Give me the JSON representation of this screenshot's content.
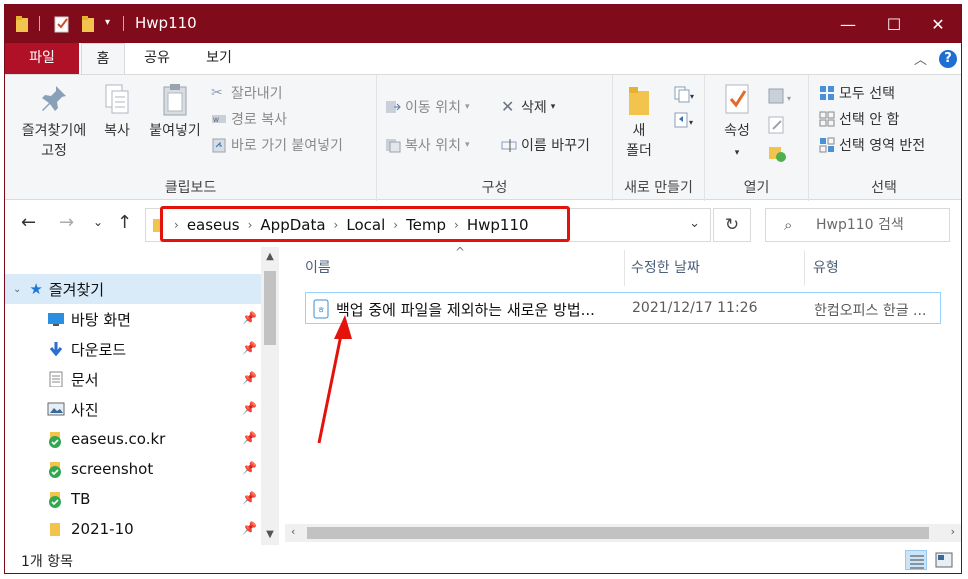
{
  "window": {
    "title": "Hwp110",
    "controls": {
      "minimize": "—",
      "maximize": "☐",
      "close": "✕"
    }
  },
  "ribbon": {
    "tabs": [
      {
        "label": "파일",
        "active": false
      },
      {
        "label": "홈",
        "active": true
      },
      {
        "label": "공유",
        "active": false
      },
      {
        "label": "보기",
        "active": false
      }
    ],
    "groups": {
      "clipboard": {
        "label": "클립보드",
        "pin_label_1": "즐겨찾기에",
        "pin_label_2": "고정",
        "copy_label": "복사",
        "paste_label": "붙여넣기",
        "cut_label": "잘라내기",
        "copy_path_label": "경로 복사",
        "paste_shortcut_label": "바로 가기 붙여넣기"
      },
      "organize": {
        "label": "구성",
        "move_to_label": "이동 위치",
        "copy_to_label": "복사 위치",
        "delete_label": "삭제",
        "rename_label": "이름 바꾸기"
      },
      "new": {
        "label": "새로 만들기",
        "new_folder_label_1": "새",
        "new_folder_label_2": "폴더"
      },
      "open": {
        "label": "열기",
        "properties_label": "속성"
      },
      "select": {
        "label": "선택",
        "select_all_label": "모두 선택",
        "select_none_label": "선택 안 함",
        "invert_label": "선택 영역 반전"
      }
    }
  },
  "address": {
    "breadcrumbs": [
      "easeus",
      "AppData",
      "Local",
      "Temp",
      "Hwp110"
    ],
    "search_placeholder": "Hwp110 검색"
  },
  "nav_pane": {
    "header": "즐겨찾기",
    "items": [
      {
        "label": "바탕 화면",
        "icon": "desktop-icon",
        "pinned": true
      },
      {
        "label": "다운로드",
        "icon": "download-icon",
        "pinned": true
      },
      {
        "label": "문서",
        "icon": "document-icon",
        "pinned": true
      },
      {
        "label": "사진",
        "icon": "pictures-icon",
        "pinned": true
      },
      {
        "label": "easeus.co.kr",
        "icon": "synced-folder-icon",
        "pinned": true
      },
      {
        "label": "screenshot",
        "icon": "synced-folder-icon",
        "pinned": true
      },
      {
        "label": "TB",
        "icon": "synced-folder-icon",
        "pinned": true
      },
      {
        "label": "2021-10",
        "icon": "folder-icon",
        "pinned": true
      }
    ]
  },
  "file_list": {
    "columns": [
      "이름",
      "수정한 날짜",
      "유형"
    ],
    "rows": [
      {
        "name": "백업 중에 파일을 제외하는 새로운 방법...",
        "modified": "2021/12/17 11:26",
        "type": "한컴오피스 한글 ..."
      }
    ]
  },
  "status": {
    "item_count": "1개 항목"
  },
  "colors": {
    "titlebar": "#7f0b1b",
    "file_tab": "#b01127",
    "highlight_box": "#e3120b",
    "nav_selected": "#d9ebf9"
  }
}
